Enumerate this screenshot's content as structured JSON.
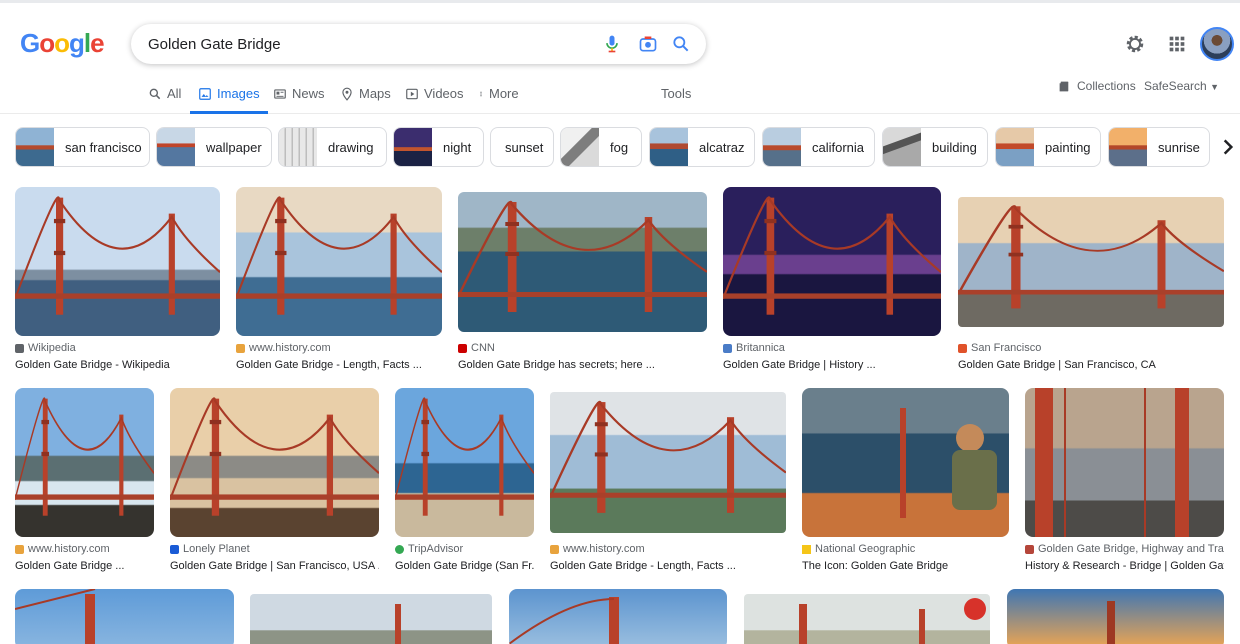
{
  "logo": {
    "letters": [
      "G",
      "o",
      "o",
      "g",
      "l",
      "e"
    ]
  },
  "search": {
    "query": "Golden Gate Bridge",
    "voice_icon": "mic-icon",
    "lens_icon": "camera-icon",
    "search_icon": "search-icon"
  },
  "header": {
    "settings_icon": "gear-icon",
    "apps_icon": "apps-grid-icon"
  },
  "tabs": [
    {
      "label": "All",
      "icon": "search-icon"
    },
    {
      "label": "Images",
      "icon": "image-icon",
      "active": true
    },
    {
      "label": "News",
      "icon": "newspaper-icon"
    },
    {
      "label": "Maps",
      "icon": "map-pin-icon"
    },
    {
      "label": "Videos",
      "icon": "play-icon"
    },
    {
      "label": "More",
      "icon": "more-vert-icon"
    }
  ],
  "tools_label": "Tools",
  "collections_label": "Collections",
  "safesearch_label": "SafeSearch",
  "chips": [
    {
      "label": "san francisco"
    },
    {
      "label": "wallpaper"
    },
    {
      "label": "drawing"
    },
    {
      "label": "night"
    },
    {
      "label": "sunset"
    },
    {
      "label": "fog"
    },
    {
      "label": "alcatraz"
    },
    {
      "label": "california"
    },
    {
      "label": "building"
    },
    {
      "label": "painting"
    },
    {
      "label": "sunrise"
    }
  ],
  "results": [
    {
      "source": "Wikipedia",
      "title": "Golden Gate Bridge - Wikipedia",
      "favicon_color": "#5f6368"
    },
    {
      "source": "www.history.com",
      "title": "Golden Gate Bridge - Length, Facts ...",
      "favicon_color": "#e8a33d"
    },
    {
      "source": "CNN",
      "title": "Golden Gate Bridge has secrets; here ...",
      "favicon_color": "#cc0000"
    },
    {
      "source": "Britannica",
      "title": "Golden Gate Bridge | History ...",
      "favicon_color": "#4a7cc7"
    },
    {
      "source": "San Francisco",
      "title": "Golden Gate Bridge | San Francisco, CA",
      "favicon_color": "#e0522a"
    },
    {
      "source": "www.history.com",
      "title": "Golden Gate Bridge ...",
      "favicon_color": "#e8a33d"
    },
    {
      "source": "Lonely Planet",
      "title": "Golden Gate Bridge | San Francisco, USA ...",
      "favicon_color": "#1a5bd6"
    },
    {
      "source": "TripAdvisor",
      "title": "Golden Gate Bridge (San Fr...",
      "favicon_color": "#34a853"
    },
    {
      "source": "www.history.com",
      "title": "Golden Gate Bridge - Length, Facts ...",
      "favicon_color": "#e8a33d"
    },
    {
      "source": "National Geographic",
      "title": "The Icon: Golden Gate Bridge",
      "favicon_color": "#f5c518"
    },
    {
      "source": "Golden Gate Bridge, Highway and Tra...",
      "title": "History & Research - Bridge | Golden Gate",
      "favicon_color": "#b5463a"
    }
  ]
}
